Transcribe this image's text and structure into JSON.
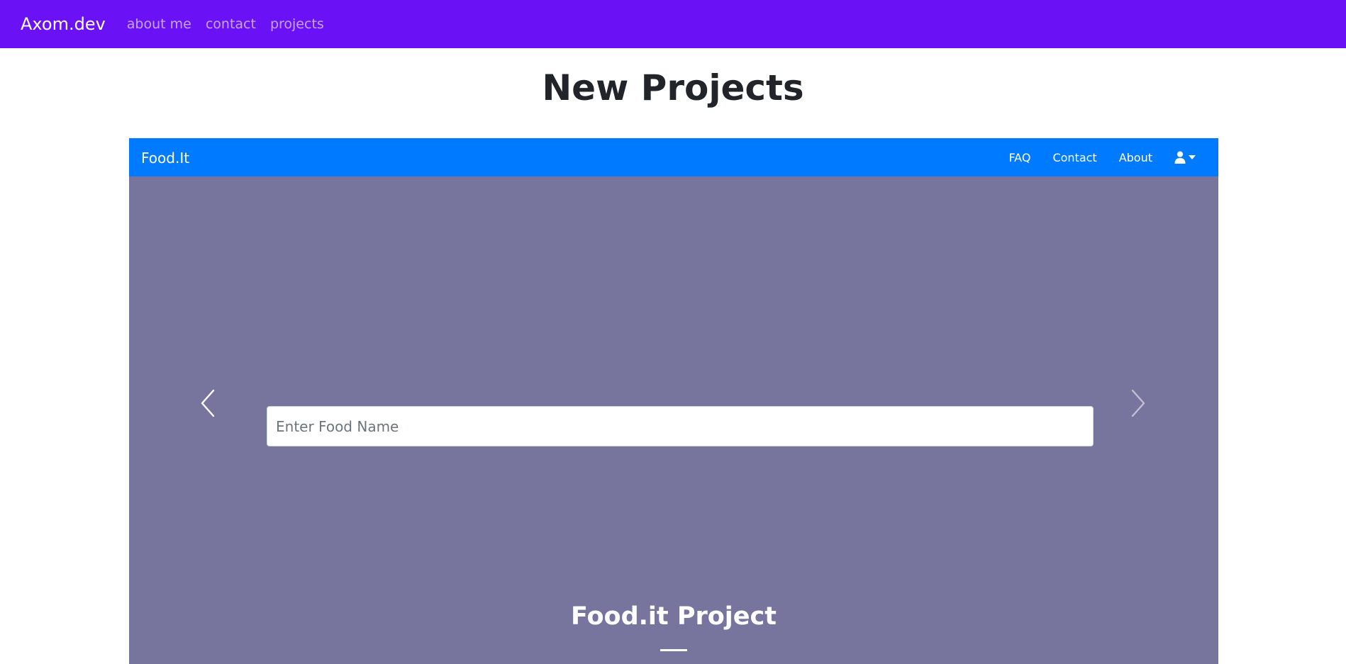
{
  "topnav": {
    "brand": "Axom.dev",
    "links": [
      "about me",
      "contact",
      "projects"
    ],
    "background": "#6a11f5"
  },
  "page": {
    "title": "New Projects"
  },
  "project_preview": {
    "navbar": {
      "brand": "Food.It",
      "links": [
        "FAQ",
        "Contact",
        "About"
      ],
      "user_menu_icon": "user-icon",
      "background": "#007bff"
    },
    "carousel": {
      "prev_icon": "chevron-left-icon",
      "next_icon": "chevron-right-icon",
      "background": "#77749e"
    },
    "search": {
      "placeholder": "Enter Food Name",
      "value": ""
    },
    "title": "Food.it Project"
  }
}
